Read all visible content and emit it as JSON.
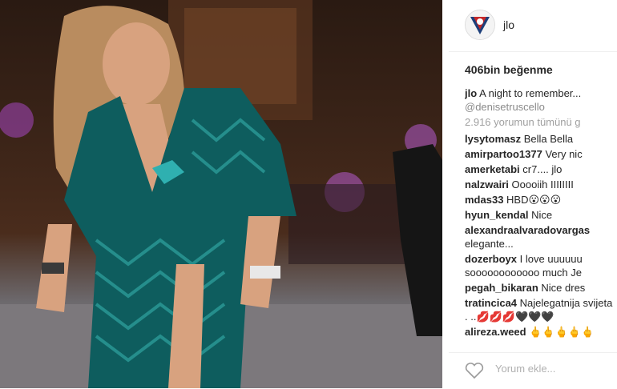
{
  "post": {
    "username": "jlo",
    "likes": "406bin beğenme"
  },
  "caption": {
    "user": "jlo",
    "text": "A night to remember...",
    "mention": "@denisetruscello"
  },
  "view_all": "2.916 yorumun tümünü g",
  "comments": [
    {
      "user": "lysytomasz",
      "text": "Bella Bella"
    },
    {
      "user": "amirpartoo1377",
      "text": "Very nic"
    },
    {
      "user": "amerketabi",
      "text": "cr7.... jlo"
    },
    {
      "user": "nalzwairi",
      "text": "Ooooiih IIIIIIII"
    },
    {
      "user": "mdas33",
      "text": "HBD😮😮😮"
    },
    {
      "user": "hyun_kendal",
      "text": "Nice"
    },
    {
      "user": "alexandraalvaradovargas",
      "text": "elegante..."
    },
    {
      "user": "dozerboyx",
      "text": "I love uuuuuu soooooooooooo much Je"
    },
    {
      "user": "pegah_bikaran",
      "text": "Nice dres"
    },
    {
      "user": "tratincica4",
      "text": "Najelegatnija svijeta . ..💋💋💋🖤🖤🖤"
    },
    {
      "user": "alireza.weed",
      "text": "🖕🖕🖕🖕🖕"
    }
  ],
  "add_comment_placeholder": "Yorum ekle...",
  "icons": {
    "like": "heart-icon",
    "avatar": "avatar-logo"
  },
  "colors": {
    "dress": "#0e5d5e",
    "text": "#262626",
    "muted": "#a0a0a0"
  }
}
